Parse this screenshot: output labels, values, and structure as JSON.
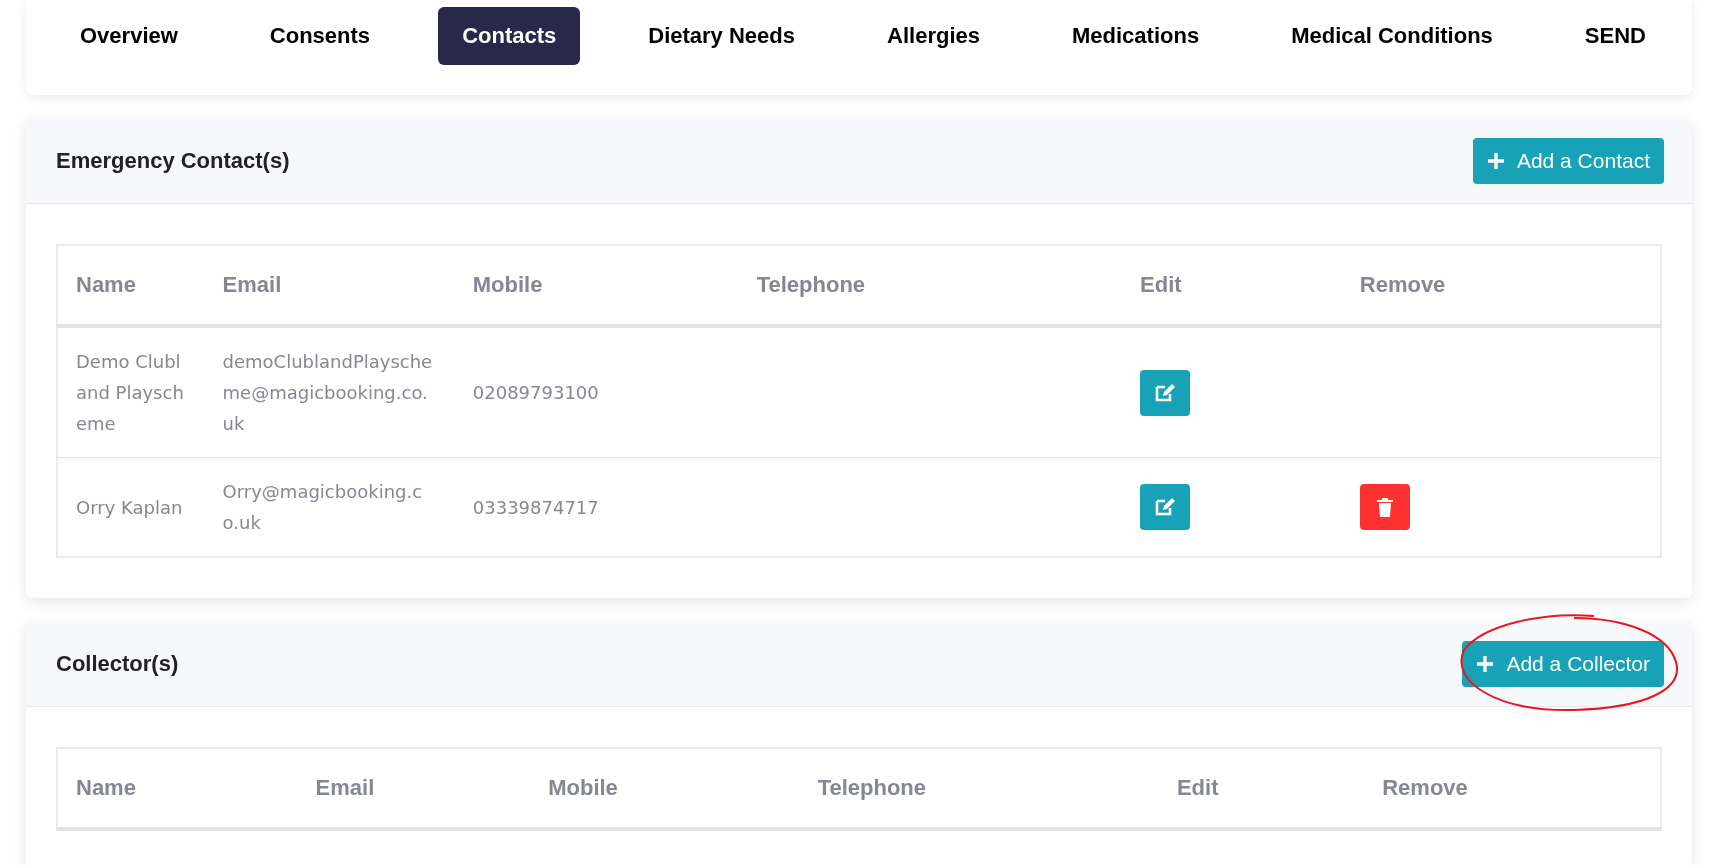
{
  "tabs": [
    {
      "label": "Overview",
      "selected": false
    },
    {
      "label": "Consents",
      "selected": false
    },
    {
      "label": "Contacts",
      "selected": true
    },
    {
      "label": "Dietary Needs",
      "selected": false
    },
    {
      "label": "Allergies",
      "selected": false
    },
    {
      "label": "Medications",
      "selected": false
    },
    {
      "label": "Medical Conditions",
      "selected": false
    },
    {
      "label": "SEND",
      "selected": false
    }
  ],
  "sections": [
    {
      "title": "Emergency Contact(s)",
      "add_button": "Add a Contact",
      "annotated": false,
      "columns": [
        "Name",
        "Email",
        "Mobile",
        "Telephone",
        "Edit",
        "Remove"
      ],
      "rows": [
        {
          "name": "Demo Clubland Playscheme",
          "email": "demoClublandPlayscheme@magicbooking.co.uk",
          "mobile": "02089793100",
          "removable": false
        },
        {
          "name": "Orry Kaplan",
          "email": "Orry@magicbooking.co.uk",
          "mobile": "03339874717",
          "removable": true
        }
      ]
    },
    {
      "title": "Collector(s)",
      "add_button": "Add a Collector",
      "annotated": true,
      "columns": [
        "Name",
        "Email",
        "Mobile",
        "Telephone",
        "Edit",
        "Remove"
      ]
    }
  ]
}
